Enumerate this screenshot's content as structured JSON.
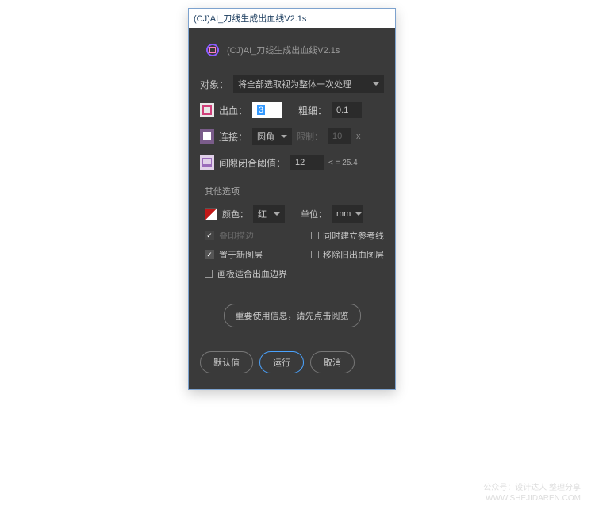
{
  "window": {
    "title": "(CJ)AI_刀线生成出血线V2.1s"
  },
  "header": {
    "title": "(CJ)AI_刀线生成出血线V2.1s"
  },
  "target": {
    "label": "对象：",
    "select_value": "将全部选取视为整体一次处理"
  },
  "bleed": {
    "label": "出血：",
    "value": "3",
    "stroke_label": "粗细：",
    "stroke_value": "0.1"
  },
  "join": {
    "label": "连接：",
    "value": "圆角",
    "limit_label": "限制：",
    "limit_value": "10",
    "unit": "x"
  },
  "gap": {
    "label": "间隙闭合阈值：",
    "value": "12",
    "note": "< = 25.4"
  },
  "other": {
    "title": "其他选项",
    "color_label": "颜色：",
    "color_value": "红",
    "unit_label": "单位：",
    "unit_value": "mm",
    "overprint_label": "叠印描边",
    "guides_label": "同时建立参考线",
    "newlayer_label": "置于新图层",
    "removeold_label": "移除旧出血图层",
    "artboard_label": "画板适合出血边界"
  },
  "buttons": {
    "info": "重要使用信息，请先点击阅览",
    "default": "默认值",
    "run": "运行",
    "cancel": "取消"
  },
  "watermark": {
    "line1": "公众号：设计达人 整理分享",
    "line2": "WWW.SHEJIDAREN.COM"
  }
}
